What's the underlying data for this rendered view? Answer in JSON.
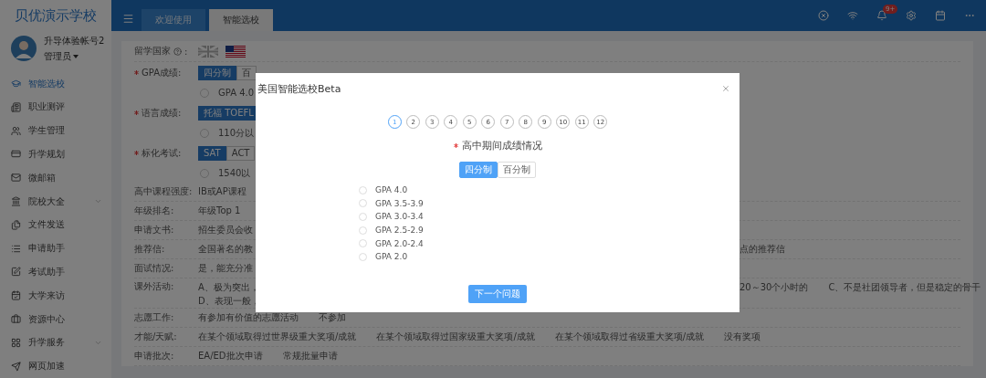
{
  "sidebar": {
    "school": "贝优演示学校",
    "user": {
      "name": "升导体验帐号2",
      "role": "管理员"
    },
    "items": [
      {
        "label": "智能选校",
        "selected": true,
        "expandable": false
      },
      {
        "label": "职业测评",
        "selected": false,
        "expandable": false
      },
      {
        "label": "学生管理",
        "selected": false,
        "expandable": false
      },
      {
        "label": "升学规划",
        "selected": false,
        "expandable": false
      },
      {
        "label": "微邮箱",
        "selected": false,
        "expandable": false
      },
      {
        "label": "院校大全",
        "selected": false,
        "expandable": true
      },
      {
        "label": "文件发送",
        "selected": false,
        "expandable": false
      },
      {
        "label": "申请助手",
        "selected": false,
        "expandable": false
      },
      {
        "label": "考试助手",
        "selected": false,
        "expandable": false
      },
      {
        "label": "大学来访",
        "selected": false,
        "expandable": false
      },
      {
        "label": "资源中心",
        "selected": false,
        "expandable": false
      },
      {
        "label": "升学服务",
        "selected": false,
        "expandable": true
      },
      {
        "label": "网页加速",
        "selected": false,
        "expandable": false
      }
    ]
  },
  "topbar": {
    "tabs": [
      {
        "label": "欢迎使用",
        "selected": false
      },
      {
        "label": "智能选校",
        "selected": true
      }
    ],
    "notification_badge": "9+"
  },
  "form": {
    "rows": [
      {
        "kind": "flags",
        "label": "留学国家",
        "help": true,
        "suffix": ":",
        "flags": [
          {
            "kind": "uk",
            "selected": false
          },
          {
            "kind": "us",
            "selected": true
          }
        ]
      },
      {
        "kind": "segment",
        "label": "GPA成绩:",
        "required": true,
        "segments": [
          {
            "label": "四分制",
            "selected": true
          },
          {
            "label": "百",
            "selected": false
          }
        ],
        "radio": {
          "label": "GPA 4.0",
          "selected": false
        }
      },
      {
        "kind": "segment",
        "label": "语言成绩:",
        "required": true,
        "segments": [
          {
            "label": "托福 TOEFL",
            "selected": true
          }
        ],
        "radio": {
          "label": "110分以",
          "selected": false
        }
      },
      {
        "kind": "segment",
        "label": "标化考试:",
        "required": true,
        "segments": [
          {
            "label": "SAT",
            "selected": true
          },
          {
            "label": "ACT",
            "selected": false
          }
        ],
        "radio": {
          "label": "1540以",
          "selected": false
        }
      },
      {
        "kind": "text",
        "label": "高中课程强度:",
        "lines": [
          [
            "IB或AP课程"
          ]
        ]
      },
      {
        "kind": "text",
        "label": "年级排名:",
        "lines": [
          [
            "年级Top 1"
          ]
        ]
      },
      {
        "kind": "text",
        "label": "申请文书:",
        "lines": [
          [
            "招生委员会收"
          ]
        ]
      },
      {
        "kind": "text",
        "label": "推荐信:",
        "lines": [
          [
            "全国著名的教"
          ]
        ],
        "right": [
          "点的推荐信"
        ]
      },
      {
        "kind": "text",
        "label": "面试情况:",
        "lines": [
          [
            "是，能充分准"
          ]
        ]
      },
      {
        "kind": "text",
        "label": "课外活动:",
        "lines": [
          [
            "A、极为突出，"
          ],
          [
            "D、表现一般，"
          ]
        ],
        "right": [
          "20～30个小时的",
          "C、不是社团领导者，但是稳定的骨干"
        ]
      },
      {
        "kind": "text",
        "label": "志愿工作:",
        "lines": [
          [
            "有参加有价值的志愿活动",
            "不参加"
          ]
        ]
      },
      {
        "kind": "text",
        "label": "才能/天赋:",
        "lines": [
          [
            "在某个领域取得过世界级重大奖项/成就",
            "在某个领域取得过国家级重大奖项/成就",
            "在某个领域取得过省级重大奖项/成就",
            "没有奖项"
          ]
        ]
      },
      {
        "kind": "text",
        "label": "申请批次:",
        "lines": [
          [
            "EA/ED批次申请",
            "常规批量申请"
          ]
        ]
      }
    ]
  },
  "modal": {
    "title": "美国智能选校Beta",
    "steps": [
      {
        "label": "1",
        "selected": true
      },
      {
        "label": "2",
        "selected": false
      },
      {
        "label": "3",
        "selected": false
      },
      {
        "label": "4",
        "selected": false
      },
      {
        "label": "5",
        "selected": false
      },
      {
        "label": "6",
        "selected": false
      },
      {
        "label": "7",
        "selected": false
      },
      {
        "label": "8",
        "selected": false
      },
      {
        "label": "9",
        "selected": false
      },
      {
        "label": "10",
        "selected": false
      },
      {
        "label": "11",
        "selected": false
      },
      {
        "label": "12",
        "selected": false
      }
    ],
    "question": {
      "text": "高中期间成绩情况",
      "required": true
    },
    "toggle": [
      {
        "label": "四分制",
        "selected": true
      },
      {
        "label": "百分制",
        "selected": false
      }
    ],
    "options": [
      {
        "label": "GPA 4.0",
        "selected": false
      },
      {
        "label": "GPA 3.5-3.9",
        "selected": false
      },
      {
        "label": "GPA 3.0-3.4",
        "selected": false
      },
      {
        "label": "GPA 2.5-2.9",
        "selected": false
      },
      {
        "label": "GPA 2.0-2.4",
        "selected": false
      },
      {
        "label": "GPA 2.0",
        "selected": false
      }
    ],
    "next_button": "下一个问题"
  }
}
